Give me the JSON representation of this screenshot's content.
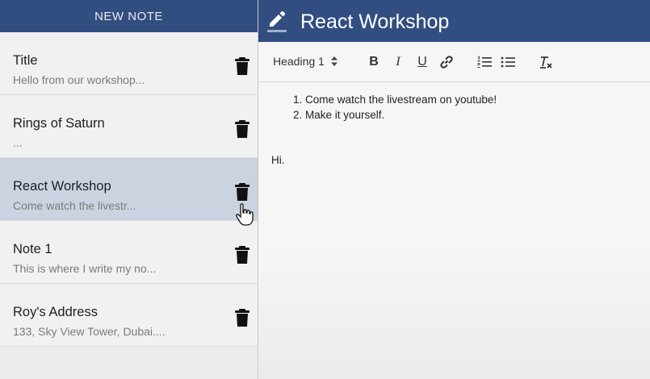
{
  "sidebar": {
    "new_note_label": "NEW NOTE",
    "notes": [
      {
        "title": "Title",
        "preview": "Hello from our workshop..."
      },
      {
        "title": "Rings of Saturn",
        "preview": "..."
      },
      {
        "title": "React Workshop",
        "preview": "Come watch the livestr...",
        "selected": true
      },
      {
        "title": "Note 1",
        "preview": "This is where I write my no..."
      },
      {
        "title": "Roy's Address",
        "preview": "133, Sky View Tower, Dubai...."
      }
    ]
  },
  "editor": {
    "title": "React Workshop",
    "toolbar": {
      "heading_select": "Heading 1",
      "bold": "B",
      "italic": "I",
      "underline": "U"
    },
    "content": {
      "list_items": [
        "Come watch the livestream on youtube!",
        "Make it yourself."
      ],
      "paragraph": "Hi."
    }
  },
  "colors": {
    "header_blue": "#324e80",
    "selected_note": "#cbd3e1"
  }
}
